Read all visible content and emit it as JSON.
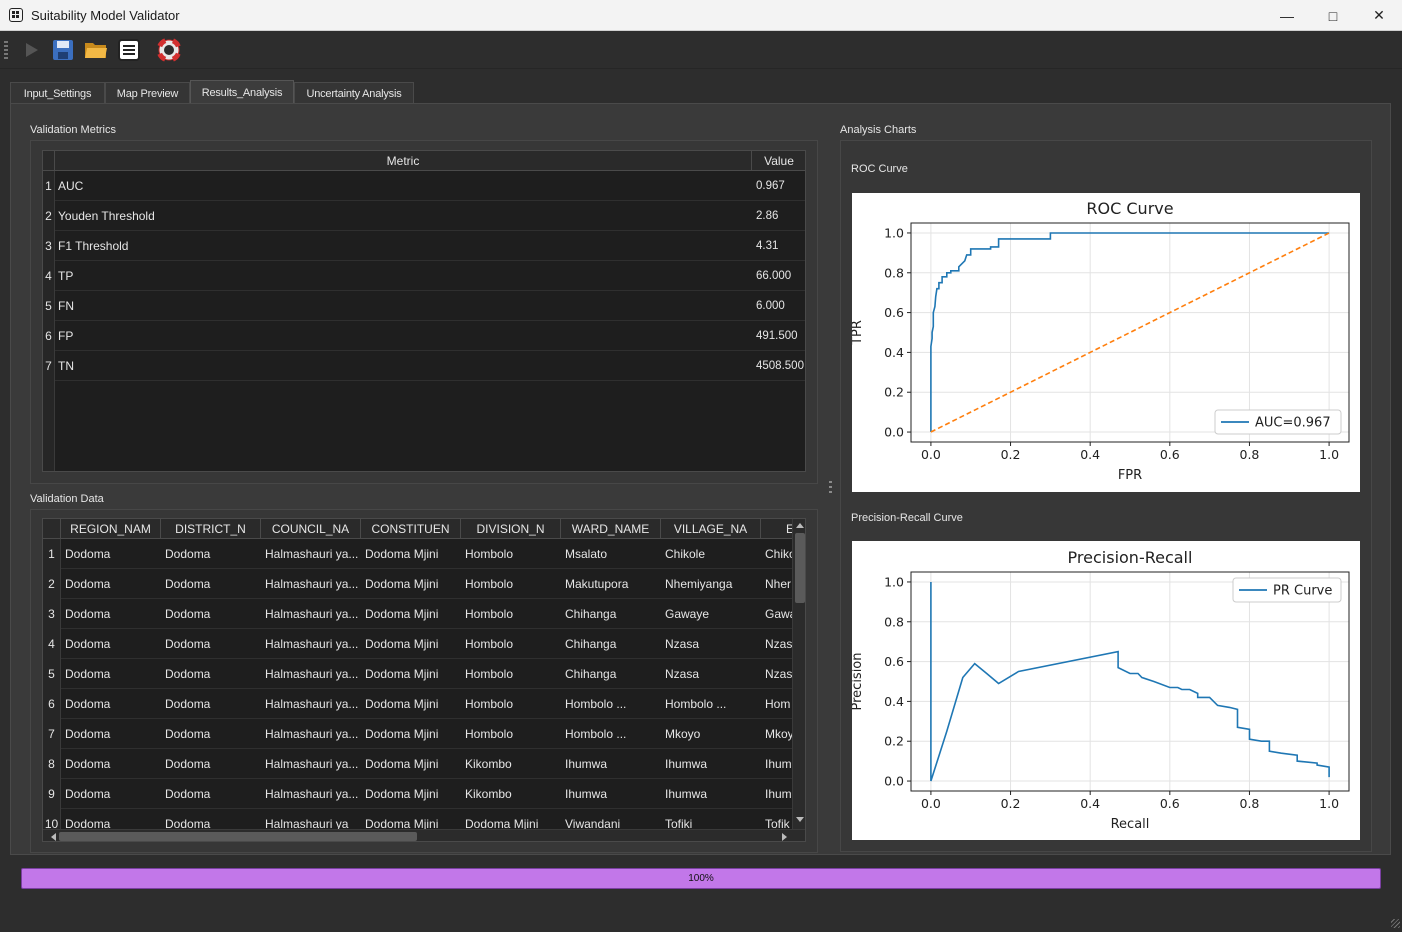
{
  "window": {
    "title": "Suitability Model Validator"
  },
  "toolbar": {
    "icons": [
      "play-icon",
      "save-icon",
      "open-folder-icon",
      "log-icon",
      "help-lifebuoy-icon"
    ]
  },
  "tabs": [
    {
      "label": "Input_Settings"
    },
    {
      "label": "Map Preview"
    },
    {
      "label": "Results_Analysis"
    },
    {
      "label": "Uncertainty Analysis"
    }
  ],
  "metrics": {
    "title": "Validation Metrics",
    "headers": [
      "Metric",
      "Value"
    ],
    "rows": [
      {
        "n": "1",
        "metric": "AUC",
        "value": "0.967"
      },
      {
        "n": "2",
        "metric": "Youden Threshold",
        "value": "2.86"
      },
      {
        "n": "3",
        "metric": "F1 Threshold",
        "value": "4.31"
      },
      {
        "n": "4",
        "metric": "TP",
        "value": "66.000"
      },
      {
        "n": "5",
        "metric": "FN",
        "value": "6.000"
      },
      {
        "n": "6",
        "metric": "FP",
        "value": "491.500"
      },
      {
        "n": "7",
        "metric": "TN",
        "value": "4508.500"
      }
    ]
  },
  "validation": {
    "title": "Validation Data",
    "headers": [
      "REGION_NAM",
      "DISTRICT_N",
      "COUNCIL_NA",
      "CONSTITUEN",
      "DIVISION_N",
      "WARD_NAME",
      "VILLAGE_NA",
      "E"
    ],
    "rows": [
      {
        "n": "1",
        "c": [
          "Dodoma",
          "Dodoma",
          "Halmashauri ya...",
          "Dodoma Mjini",
          "Hombolo",
          "Msalato",
          "Chikole",
          "Chiko"
        ]
      },
      {
        "n": "2",
        "c": [
          "Dodoma",
          "Dodoma",
          "Halmashauri ya...",
          "Dodoma Mjini",
          "Hombolo",
          "Makutupora",
          "Nhemiyanga",
          "Nher"
        ]
      },
      {
        "n": "3",
        "c": [
          "Dodoma",
          "Dodoma",
          "Halmashauri ya...",
          "Dodoma Mjini",
          "Hombolo",
          "Chihanga",
          "Gawaye",
          "Gawa"
        ]
      },
      {
        "n": "4",
        "c": [
          "Dodoma",
          "Dodoma",
          "Halmashauri ya...",
          "Dodoma Mjini",
          "Hombolo",
          "Chihanga",
          "Nzasa",
          "Nzasa"
        ]
      },
      {
        "n": "5",
        "c": [
          "Dodoma",
          "Dodoma",
          "Halmashauri ya...",
          "Dodoma Mjini",
          "Hombolo",
          "Chihanga",
          "Nzasa",
          "Nzasa"
        ]
      },
      {
        "n": "6",
        "c": [
          "Dodoma",
          "Dodoma",
          "Halmashauri ya...",
          "Dodoma Mjini",
          "Hombolo",
          "Hombolo ...",
          "Hombolo ...",
          "Hom"
        ]
      },
      {
        "n": "7",
        "c": [
          "Dodoma",
          "Dodoma",
          "Halmashauri ya...",
          "Dodoma Mjini",
          "Hombolo",
          "Hombolo ...",
          "Mkoyo",
          "Mkoy"
        ]
      },
      {
        "n": "8",
        "c": [
          "Dodoma",
          "Dodoma",
          "Halmashauri ya...",
          "Dodoma Mjini",
          "Kikombo",
          "Ihumwa",
          "Ihumwa",
          "Ihum"
        ]
      },
      {
        "n": "9",
        "c": [
          "Dodoma",
          "Dodoma",
          "Halmashauri ya...",
          "Dodoma Mjini",
          "Kikombo",
          "Ihumwa",
          "Ihumwa",
          "Ihum"
        ]
      },
      {
        "n": "10",
        "c": [
          "Dodoma",
          "Dodoma",
          "Halmashauri ya",
          "Dodoma Mjini",
          "Dodoma Mjini",
          "Viwandani",
          "Tofiki",
          "Tofik"
        ]
      }
    ]
  },
  "charts_group": {
    "title": "Analysis Charts",
    "roc_label": "ROC Curve",
    "pr_label": "Precision-Recall Curve"
  },
  "chart_data": [
    {
      "type": "line",
      "title": "ROC Curve",
      "xlabel": "FPR",
      "ylabel": "TPR",
      "xlim": [
        0,
        1
      ],
      "ylim": [
        0,
        1
      ],
      "xticks": [
        "0.0",
        "0.2",
        "0.4",
        "0.6",
        "0.8",
        "1.0"
      ],
      "yticks": [
        "0.0",
        "0.2",
        "0.4",
        "0.6",
        "0.8",
        "1.0"
      ],
      "grid": true,
      "legend": "lower right",
      "series": [
        {
          "name": "AUC=0.967",
          "color": "#1f77b4",
          "style": "solid",
          "x": [
            0,
            0,
            0.003,
            0.003,
            0.006,
            0.006,
            0.01,
            0.012,
            0.015,
            0.02,
            0.02,
            0.028,
            0.028,
            0.04,
            0.04,
            0.05,
            0.05,
            0.07,
            0.07,
            0.085,
            0.09,
            0.1,
            0.1,
            0.15,
            0.15,
            0.17,
            0.17,
            0.3,
            0.3,
            1.0
          ],
          "y": [
            0,
            0.43,
            0.47,
            0.5,
            0.53,
            0.6,
            0.63,
            0.68,
            0.72,
            0.72,
            0.75,
            0.75,
            0.78,
            0.78,
            0.8,
            0.8,
            0.81,
            0.81,
            0.83,
            0.86,
            0.89,
            0.89,
            0.92,
            0.92,
            0.93,
            0.93,
            0.97,
            0.97,
            1.0,
            1.0
          ]
        },
        {
          "name": "",
          "color": "#ff7f0e",
          "style": "dashed",
          "x": [
            0,
            1
          ],
          "y": [
            0,
            1
          ]
        }
      ]
    },
    {
      "type": "line",
      "title": "Precision-Recall",
      "xlabel": "Recall",
      "ylabel": "Precision",
      "xlim": [
        0,
        1
      ],
      "ylim": [
        0,
        1
      ],
      "xticks": [
        "0.0",
        "0.2",
        "0.4",
        "0.6",
        "0.8",
        "1.0"
      ],
      "yticks": [
        "0.0",
        "0.2",
        "0.4",
        "0.6",
        "0.8",
        "1.0"
      ],
      "grid": true,
      "legend": "upper right",
      "series": [
        {
          "name": "PR Curve",
          "color": "#1f77b4",
          "style": "solid",
          "x": [
            0,
            0,
            0.04,
            0.08,
            0.11,
            0.14,
            0.17,
            0.22,
            0.47,
            0.47,
            0.5,
            0.52,
            0.53,
            0.56,
            0.6,
            0.62,
            0.63,
            0.65,
            0.67,
            0.67,
            0.7,
            0.72,
            0.75,
            0.75,
            0.77,
            0.77,
            0.8,
            0.8,
            0.83,
            0.85,
            0.85,
            0.88,
            0.92,
            0.92,
            0.97,
            0.97,
            1.0,
            1.0
          ],
          "y": [
            1.0,
            0.0,
            0.25,
            0.52,
            0.59,
            0.54,
            0.49,
            0.55,
            0.65,
            0.57,
            0.54,
            0.54,
            0.52,
            0.5,
            0.47,
            0.47,
            0.46,
            0.46,
            0.44,
            0.42,
            0.42,
            0.38,
            0.37,
            0.37,
            0.36,
            0.27,
            0.26,
            0.21,
            0.2,
            0.2,
            0.15,
            0.14,
            0.13,
            0.1,
            0.09,
            0.08,
            0.07,
            0.02
          ]
        }
      ]
    }
  ],
  "progress": {
    "text": "100%",
    "value": 1.0
  }
}
